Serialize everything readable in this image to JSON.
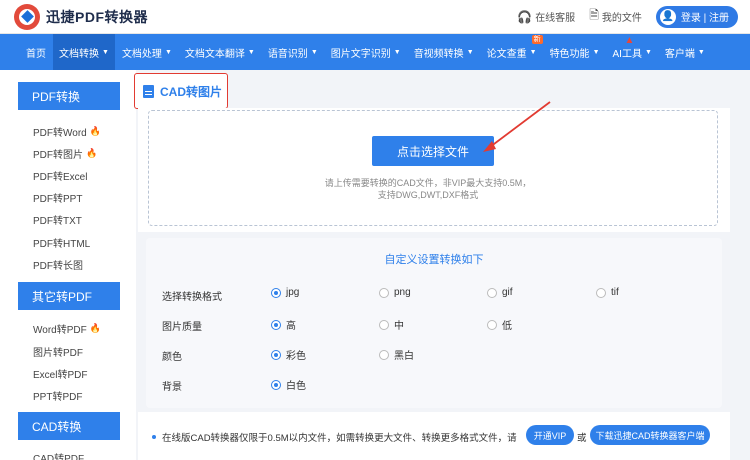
{
  "header": {
    "logo_text": "迅捷PDF转换器",
    "online_service": "在线客服",
    "my_files": "我的文件",
    "login": "登录 | 注册"
  },
  "nav": {
    "items": [
      {
        "label": "首页"
      },
      {
        "label": "文档转换"
      },
      {
        "label": "文档处理"
      },
      {
        "label": "文档文本翻译"
      },
      {
        "label": "语音识别"
      },
      {
        "label": "图片文字识别"
      },
      {
        "label": "音视频转换"
      },
      {
        "label": "论文查重"
      },
      {
        "label": "特色功能"
      },
      {
        "label": "AI工具"
      },
      {
        "label": "客户端"
      }
    ],
    "new_badge": "新"
  },
  "sidebar": {
    "groups": [
      {
        "title": "PDF转换",
        "items": [
          "PDF转Word",
          "PDF转图片",
          "PDF转Excel",
          "PDF转PPT",
          "PDF转TXT",
          "PDF转HTML",
          "PDF转长图"
        ]
      },
      {
        "title": "其它转PDF",
        "items": [
          "Word转PDF",
          "图片转PDF",
          "Excel转PDF",
          "PPT转PDF"
        ]
      },
      {
        "title": "CAD转换",
        "items": [
          "CAD转PDF"
        ]
      }
    ]
  },
  "main": {
    "title": "CAD转图片",
    "upload_button": "点击选择文件",
    "upload_tip_1": "请上传需要转换的CAD文件，非VIP最大支持0.5M，",
    "upload_tip_2": "支持DWG,DWT,DXF格式"
  },
  "settings": {
    "title": "自定义设置转换如下",
    "rows": [
      {
        "label": "选择转换格式",
        "options": [
          "jpg",
          "png",
          "gif",
          "tif"
        ],
        "selected": 0
      },
      {
        "label": "图片质量",
        "options": [
          "高",
          "中",
          "低"
        ],
        "selected": 0
      },
      {
        "label": "颜色",
        "options": [
          "彩色",
          "黑白"
        ],
        "selected": 0
      },
      {
        "label": "背景",
        "options": [
          "白色"
        ],
        "selected": 0
      }
    ]
  },
  "footer": {
    "notice": "在线版CAD转换器仅限于0.5M以内文件，如需转换更大文件、转换更多格式文件，请",
    "vip_button": "开通VIP",
    "or": "或",
    "download_button": "下载迅捷CAD转换器客户端"
  },
  "colors": {
    "brand": "#2f80ea",
    "highlight": "#e23b32"
  }
}
